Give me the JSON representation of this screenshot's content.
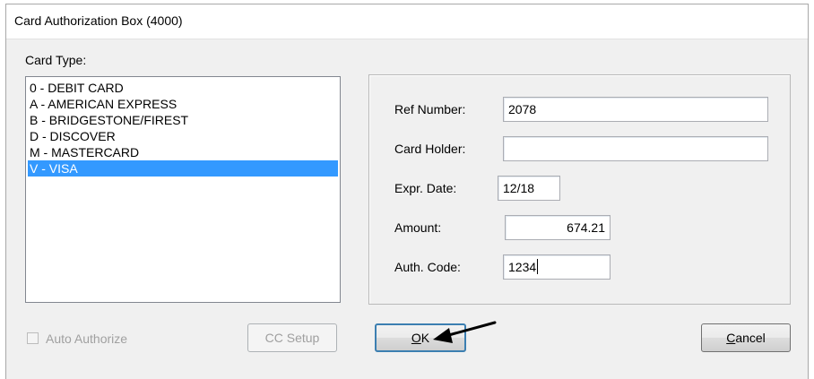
{
  "window": {
    "title": "Card Authorization Box (4000)"
  },
  "card_type": {
    "label": "Card Type:",
    "items": [
      "0 - DEBIT CARD",
      "A - AMERICAN EXPRESS",
      "B - BRIDGESTONE/FIREST",
      "D - DISCOVER",
      "M - MASTERCARD",
      "V - VISA"
    ],
    "selected": "V - VISA"
  },
  "form": {
    "ref_number": {
      "label": "Ref Number:",
      "value": "2078"
    },
    "card_holder": {
      "label": "Card Holder:",
      "value": ""
    },
    "expr_date": {
      "label": "Expr. Date:",
      "value": "12/18"
    },
    "amount": {
      "label": "Amount:",
      "value": "674.21"
    },
    "auth_code": {
      "label": "Auth. Code:",
      "value": "1234"
    }
  },
  "auto_authorize": {
    "label": "Auto Authorize",
    "checked": false,
    "enabled": false
  },
  "buttons": {
    "cc_setup": "CC Setup",
    "ok_hotkey": "O",
    "ok_rest": "K",
    "cancel_hotkey": "C",
    "cancel_rest": "ancel"
  },
  "icons": {
    "pointer": "arrow-pointer-icon"
  }
}
